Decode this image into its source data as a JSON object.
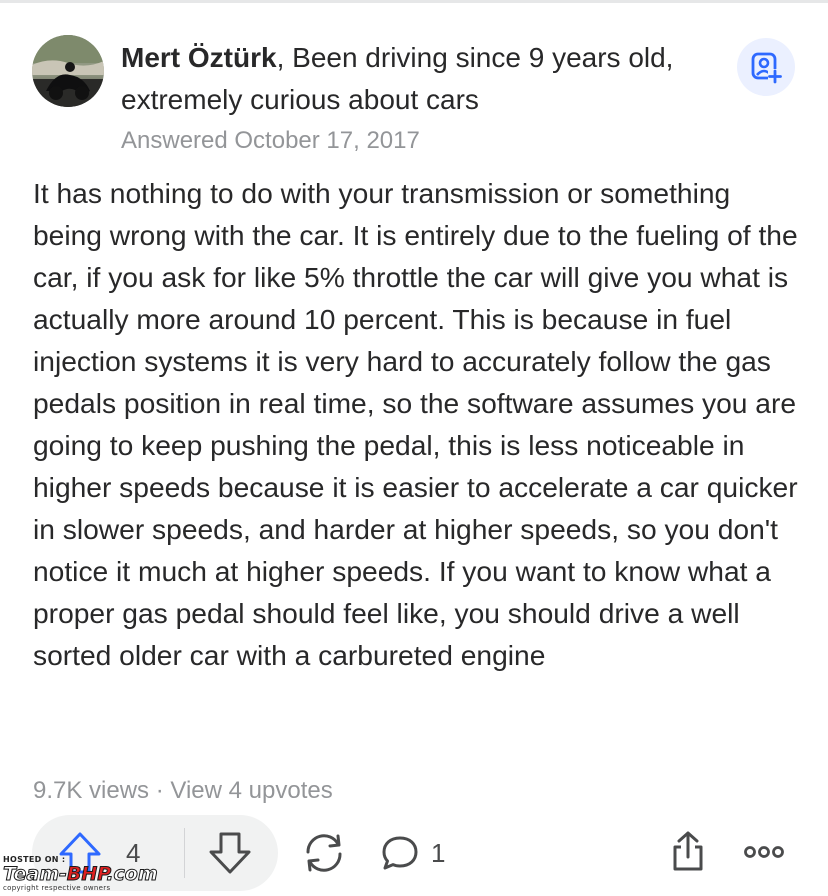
{
  "author": {
    "name": "Mert Öztürk",
    "credential": ", Been driving since 9 years old, extremely curious about cars",
    "answered": "Answered October 17, 2017"
  },
  "answer": {
    "text": "It has nothing to do with your transmission or something being wrong with the car. It is entirely due to the fueling of the car, if you ask for like 5% throttle the car will give you what is actually more around 10 percent. This is because in fuel injection systems it is very hard to accurately follow the gas pedals position in real time, so the software assumes you are going to keep pushing the pedal, this is less noticeable in higher speeds because it is easier to accelerate a car quicker in slower speeds, and harder at higher speeds, so you don't notice it much at higher speeds. If you want to know what a proper gas pedal should feel like, you should drive a well sorted older car with a carbureted engine"
  },
  "stats": {
    "views": "9.7K views",
    "separator": " · ",
    "upvotes_link": "View 4 upvotes"
  },
  "actions": {
    "upvote_count": "4",
    "comment_count": "1"
  },
  "watermark": {
    "hosted": "HOSTED ON :",
    "site_prefix": "Team-",
    "site_accent": "BHP",
    "site_suffix": ".com",
    "copyright": "copyright respective owners"
  },
  "icons": {
    "follow": "add-person-icon",
    "upvote": "upvote-arrow-icon",
    "downvote": "downvote-arrow-icon",
    "share": "repost-icon",
    "comment": "comment-bubble-icon",
    "export": "share-icon",
    "more": "more-dots-icon"
  },
  "colors": {
    "text": "#282829",
    "muted": "#939598",
    "accent": "#2e69ff",
    "follow_bg": "#ebf0ff",
    "pill_bg": "#f1f2f2"
  }
}
